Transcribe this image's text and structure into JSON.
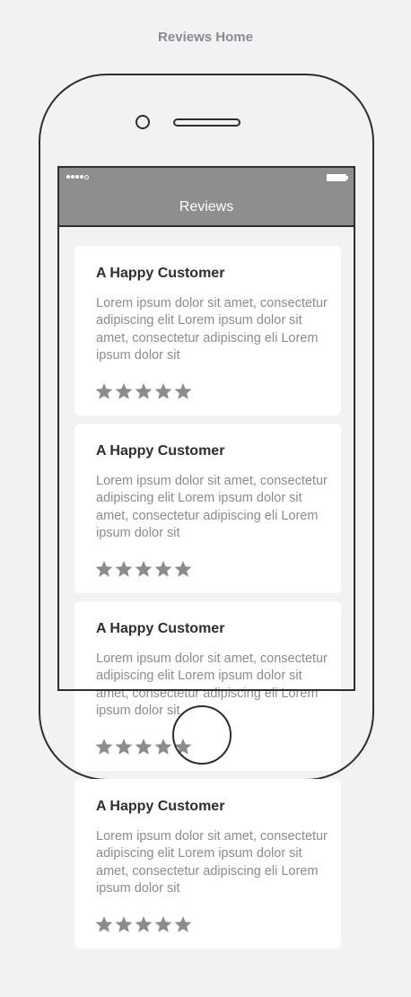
{
  "page": {
    "title": "Reviews Home"
  },
  "status_bar": {
    "signal_icon": "signal-dots-icon",
    "battery_icon": "battery-icon"
  },
  "app": {
    "header_title": "Reviews"
  },
  "reviews": [
    {
      "title": "A Happy Customer",
      "body": "Lorem ipsum dolor sit amet, consectetur adipiscing elit Lorem ipsum dolor sit amet, consectetur adipiscing eli Lorem ipsum dolor sit",
      "rating": 5
    },
    {
      "title": "A Happy Customer",
      "body": "Lorem ipsum dolor sit amet, consectetur adipiscing elit Lorem ipsum dolor sit amet, consectetur adipiscing eli Lorem ipsum dolor sit",
      "rating": 5
    },
    {
      "title": "A Happy Customer",
      "body": "Lorem ipsum dolor sit amet, consectetur adipiscing elit Lorem ipsum dolor sit amet, consectetur adipiscing eli Lorem ipsum dolor sit",
      "rating": 5
    },
    {
      "title": "A Happy Customer",
      "body": "Lorem ipsum dolor sit amet, consectetur adipiscing elit Lorem ipsum dolor sit amet, consectetur adipiscing eli Lorem ipsum dolor sit",
      "rating": 5
    }
  ],
  "colors": {
    "background": "#f1f2f4",
    "header": "#8e8e91",
    "outline": "#2e2e30",
    "star": "#8c8c90",
    "body_text": "#8c8c90",
    "title_text": "#2e2e30"
  }
}
